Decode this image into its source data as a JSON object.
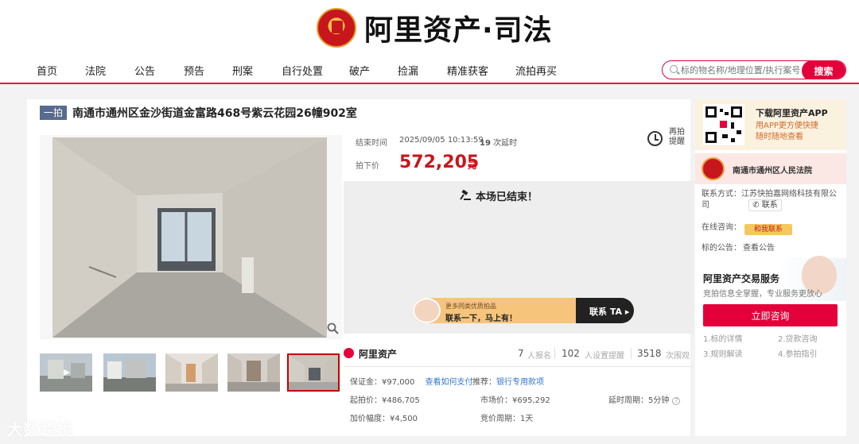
{
  "site": {
    "logo_text": "阿里资产·司法"
  },
  "nav": {
    "items": [
      "首页",
      "法院",
      "公告",
      "预告",
      "刑案",
      "自行处置",
      "破产",
      "捡漏",
      "精准获客",
      "流拍再买"
    ]
  },
  "search": {
    "placeholder": "标的物名称/地理位置/执行案号",
    "button": "搜索"
  },
  "listing": {
    "badge": "一拍",
    "title": "南通市通州区金沙街道金富路468号紫云花园26幢902室",
    "end_time_label": "结束时间",
    "end_time": "2025/09/05 10:13:59",
    "delay_count": "19",
    "delay_label": "次延时",
    "price_label": "拍下价",
    "price": "572,205",
    "price_unit": "元",
    "remind": "再拍提醒",
    "ended_message": "本场已结束！",
    "ad_small": "更多同类优质拍品",
    "ad_big": "联系一下，马上有！",
    "ad_button": "联系 TA ▸",
    "brand": "阿里资产",
    "stats": [
      {
        "num": "7",
        "label": "人报名"
      },
      {
        "num": "102",
        "label": "人设置提醒"
      },
      {
        "num": "3518",
        "label": "次围观"
      }
    ],
    "deposit_label": "保证金：",
    "deposit": "¥97,000",
    "how_pay": "查看如何支付",
    "recommend_label": "推荐：",
    "recommend": "银行专用款项",
    "start_label": "起拍价：",
    "start_price": "¥486,705",
    "market_label": "市场价：",
    "market_price": "¥695,292",
    "delay_cycle_label": "延时周期：",
    "delay_cycle": "5分钟",
    "increment_label": "加价幅度：",
    "increment": "¥4,500",
    "bid_cycle_label": "竞价周期：",
    "bid_cycle": "1天"
  },
  "side": {
    "app_title": "下载阿里资产APP",
    "app_sub1": "用APP更方便快捷",
    "app_sub2": "随时随地查看",
    "court_name": "南通市通州区人民法院",
    "contact_label": "联系方式：",
    "contact_value": "江苏快拍嘉网络科技有限公司",
    "contact_button": "联系",
    "online_label": "在线咨询：",
    "online_button": "和我联系",
    "notice_label": "标的公告：",
    "notice_link": "查看公告",
    "service_title": "阿里资产交易服务",
    "service_sub": "竞拍信息全掌握，专业服务更放心",
    "consult_button": "立即咨询",
    "tips": [
      "1.标的详情",
      "2.贷款咨询",
      "3.规则解读",
      "4.参拍指引"
    ]
  },
  "watermark": "大数跨境"
}
